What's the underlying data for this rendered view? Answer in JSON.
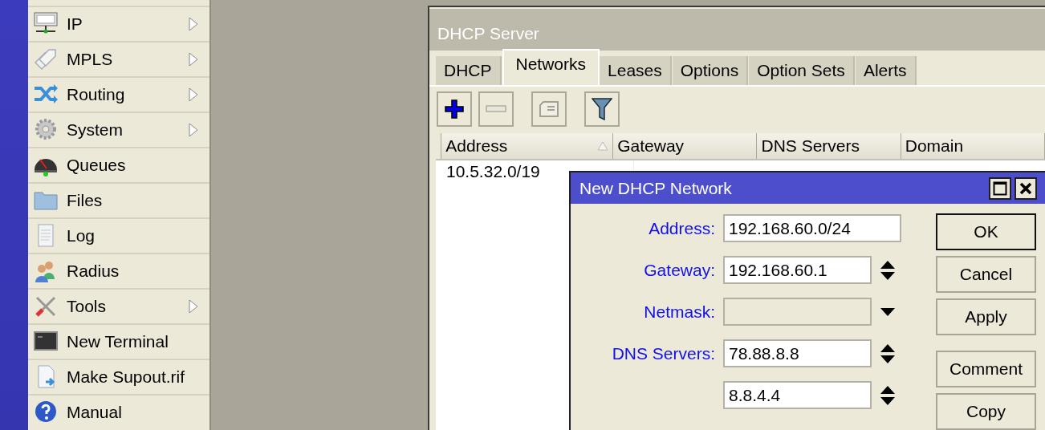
{
  "menu": {
    "items": [
      {
        "label": "IP",
        "submenu": true
      },
      {
        "label": "MPLS",
        "submenu": true
      },
      {
        "label": "Routing",
        "submenu": true
      },
      {
        "label": "System",
        "submenu": true
      },
      {
        "label": "Queues",
        "submenu": false
      },
      {
        "label": "Files",
        "submenu": false
      },
      {
        "label": "Log",
        "submenu": false
      },
      {
        "label": "Radius",
        "submenu": false
      },
      {
        "label": "Tools",
        "submenu": true
      },
      {
        "label": "New Terminal",
        "submenu": false
      },
      {
        "label": "Make Supout.rif",
        "submenu": false
      },
      {
        "label": "Manual",
        "submenu": false
      }
    ]
  },
  "dhcp_window": {
    "title": "DHCP Server",
    "tabs": [
      {
        "label": "DHCP",
        "selected": false
      },
      {
        "label": "Networks",
        "selected": true
      },
      {
        "label": "Leases",
        "selected": false
      },
      {
        "label": "Options",
        "selected": false
      },
      {
        "label": "Option Sets",
        "selected": false
      },
      {
        "label": "Alerts",
        "selected": false
      }
    ],
    "table": {
      "columns": [
        {
          "label": "Address",
          "sorted": true
        },
        {
          "label": "Gateway",
          "sorted": false
        },
        {
          "label": "DNS Servers",
          "sorted": false
        },
        {
          "label": "Domain",
          "sorted": false
        }
      ],
      "rows": [
        [
          "10.5.32.0/19"
        ]
      ]
    }
  },
  "dialog": {
    "title": "New DHCP Network",
    "fields": [
      {
        "label": "Address:",
        "value": "192.168.60.0/24",
        "kind": "text"
      },
      {
        "label": "Gateway:",
        "value": "192.168.60.1",
        "kind": "spin"
      },
      {
        "label": "Netmask:",
        "kind": "dropdown",
        "disabled": true
      },
      {
        "label": "DNS Servers:",
        "value": "78.88.8.8",
        "kind": "spin"
      },
      {
        "value": "8.8.4.4",
        "kind": "spin"
      }
    ],
    "buttons": [
      {
        "label": "OK",
        "default": true
      },
      {
        "label": "Cancel",
        "default": false
      },
      {
        "label": "Apply",
        "default": false
      },
      {
        "label": "Comment",
        "default": false
      },
      {
        "label": "Copy",
        "default": false
      }
    ]
  }
}
